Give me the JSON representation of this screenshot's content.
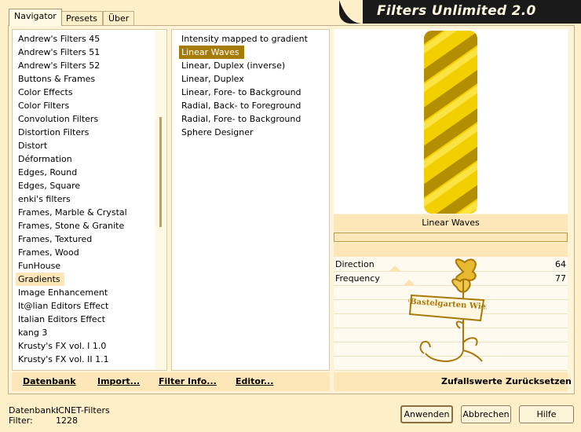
{
  "window": {
    "title": "Filters Unlimited 2.0"
  },
  "tabs": [
    {
      "label": "Navigator",
      "active": true
    },
    {
      "label": "Presets",
      "active": false
    },
    {
      "label": "Über",
      "active": false
    }
  ],
  "categories": [
    "Andrew's Filters 45",
    "Andrew's Filters 51",
    "Andrew's Filters 52",
    "Buttons & Frames",
    "Color Effects",
    "Color Filters",
    "Convolution Filters",
    "Distortion Filters",
    "Distort",
    "Déformation",
    "Edges, Round",
    "Edges, Square",
    "enki's filters",
    "Frames, Marble & Crystal",
    "Frames, Stone & Granite",
    "Frames, Textured",
    "Frames, Wood",
    "FunHouse",
    "Gradients",
    "Image Enhancement",
    "It@lian Editors Effect",
    "Italian Editors Effect",
    "kang 3",
    "Krusty's FX vol. I 1.0",
    "Krusty's FX vol. II 1.1"
  ],
  "selected_category": "Gradients",
  "filters": [
    "Intensity mapped to gradient",
    "Linear Waves",
    "Linear, Duplex (inverse)",
    "Linear, Duplex",
    "Linear, Fore- to Background",
    "Radial, Back- to Foreground",
    "Radial, Fore- to Background",
    "Sphere Designer"
  ],
  "selected_filter": "Linear Waves",
  "preview": {
    "filter_name": "Linear Waves",
    "watermark_text": "©Bastelgarten Wien"
  },
  "params": [
    {
      "name": "Direction",
      "value": "64",
      "slider": 0.25
    },
    {
      "name": "Frequency",
      "value": "77",
      "slider": 0.3
    }
  ],
  "toolbar": {
    "datenbank": "Datenbank",
    "import": "Import...",
    "filter_info": "Filter Info...",
    "editor": "Editor...",
    "zufallswerte": "Zufallswerte",
    "zuruecksetzen": "Zurücksetzen"
  },
  "status": {
    "datenbank_label": "Datenbank:",
    "datenbank_value": "ICNET-Filters",
    "filter_label": "Filter:",
    "filter_value": "1228"
  },
  "buttons": {
    "anwenden": "Anwenden",
    "abbrechen": "Abbrechen",
    "hilfe": "Hilfe"
  },
  "colors": {
    "background": "#fdf0c8",
    "selection": "#a77b08",
    "gold": "#e8b800",
    "header": "#1a1a1a"
  }
}
